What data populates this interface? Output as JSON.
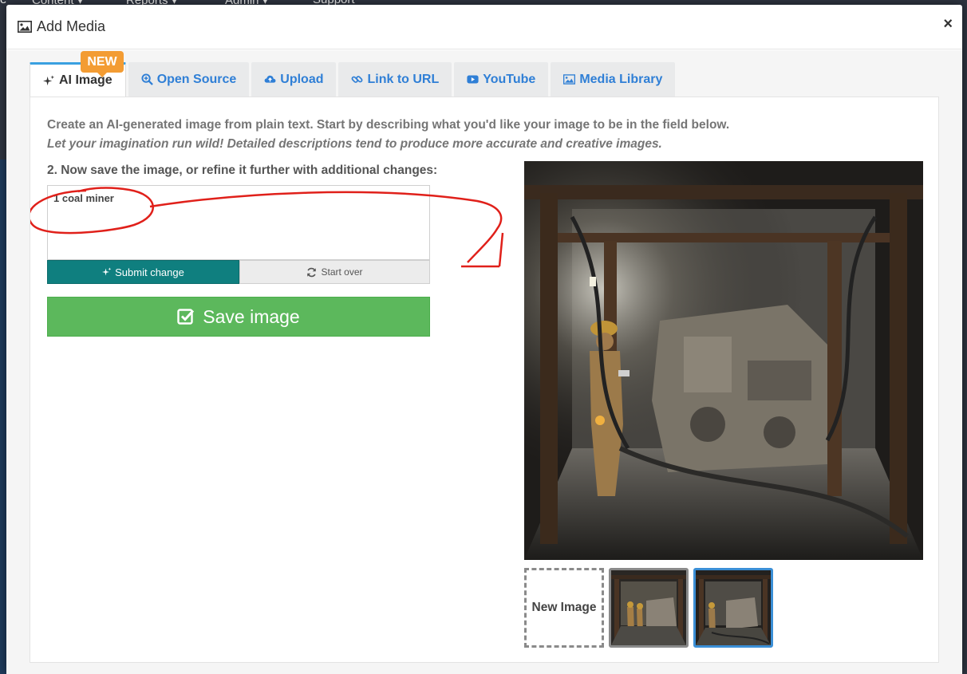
{
  "background_nav": {
    "items": [
      "e",
      "Content ▾",
      "Reports ▾",
      "Admin ▾",
      "Support"
    ]
  },
  "modal": {
    "title": "Add Media",
    "close_label": "×"
  },
  "badge": "NEW",
  "tabs": [
    {
      "label": "AI Image",
      "icon": "sparkle-icon",
      "active": true
    },
    {
      "label": "Open Source",
      "icon": "search-plus-icon"
    },
    {
      "label": "Upload",
      "icon": "cloud-upload-icon"
    },
    {
      "label": "Link to URL",
      "icon": "link-icon"
    },
    {
      "label": "YouTube",
      "icon": "youtube-icon"
    },
    {
      "label": "Media Library",
      "icon": "image-icon"
    }
  ],
  "panel": {
    "intro_line1": "Create an AI-generated image from plain text. Start by describing what you'd like your image to be in the field below.",
    "intro_line2": "Let your imagination run wild! Detailed descriptions tend to produce more accurate and creative images.",
    "step_label": "2. Now save the image, or refine it further with additional changes:",
    "prompt_value": "1 coal miner",
    "submit_label": "Submit change",
    "startover_label": "Start over",
    "save_label": "Save image"
  },
  "thumbnails": {
    "new_label": "New Image",
    "items": [
      {
        "icon": "thumbnail-two-miners",
        "selected": false
      },
      {
        "icon": "thumbnail-one-miner",
        "selected": true
      }
    ]
  },
  "colors": {
    "tab_accent": "#3aa0e0",
    "link_blue": "#2f7fd6",
    "badge_orange": "#f39c33",
    "submit_teal": "#0f7f7f",
    "save_green": "#5cb85c",
    "annotation_red": "#e0201a"
  }
}
